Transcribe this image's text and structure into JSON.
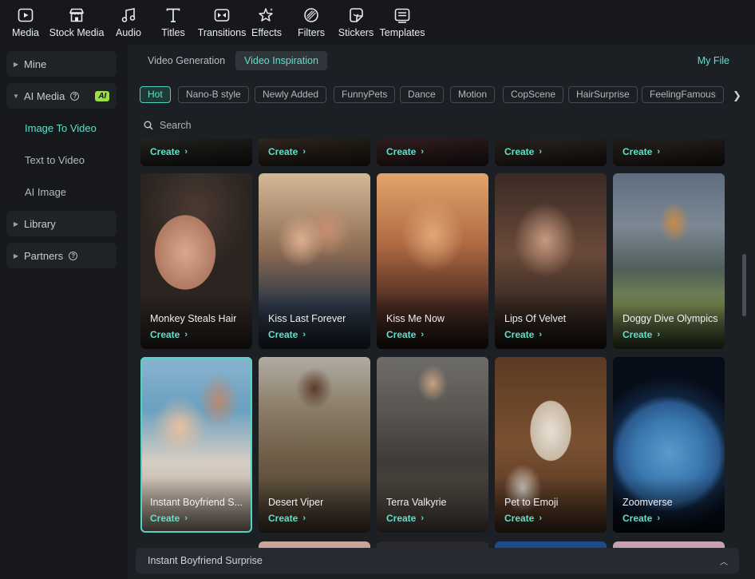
{
  "toolbar": {
    "items": [
      {
        "label": "Media",
        "icon": "media-icon",
        "active": false
      },
      {
        "label": "Stock Media",
        "icon": "store-icon",
        "active": true
      },
      {
        "label": "Audio",
        "icon": "music-note-icon",
        "active": false
      },
      {
        "label": "Titles",
        "icon": "text-t-icon",
        "active": false
      },
      {
        "label": "Transitions",
        "icon": "transition-icon",
        "active": false
      },
      {
        "label": "Effects",
        "icon": "sparkle-star-icon",
        "active": false
      },
      {
        "label": "Filters",
        "icon": "filter-circle-icon",
        "active": false
      },
      {
        "label": "Stickers",
        "icon": "sticker-icon",
        "active": false
      },
      {
        "label": "Templates",
        "icon": "template-icon",
        "active": false
      }
    ]
  },
  "sidebar": {
    "mine": "Mine",
    "ai_media": "AI Media",
    "ai_badge": "AI",
    "image_to_video": "Image To Video",
    "text_to_video": "Text to Video",
    "ai_image": "AI Image",
    "library": "Library",
    "partners": "Partners"
  },
  "tabs": {
    "video_generation": "Video Generation",
    "video_inspiration": "Video Inspiration",
    "my_file": "My File"
  },
  "chips": [
    "Hot",
    "Nano-B style",
    "Newly Added",
    "FunnyPets",
    "Dance",
    "Motion",
    "CopScene",
    "HairSurprise",
    "FeelingFamous"
  ],
  "search": {
    "placeholder": "Search"
  },
  "create_label": "Create",
  "cards_row2": [
    {
      "title": "Monkey Steals Hair"
    },
    {
      "title": "Kiss Last Forever"
    },
    {
      "title": "Kiss Me Now"
    },
    {
      "title": "Lips Of Velvet"
    },
    {
      "title": "Doggy Dive Olympics"
    }
  ],
  "cards_row3": [
    {
      "title": "Instant Boyfriend S..."
    },
    {
      "title": "Desert Viper"
    },
    {
      "title": "Terra Valkyrie"
    },
    {
      "title": "Pet to Emoji"
    },
    {
      "title": "Zoomverse"
    }
  ],
  "bottom_bar": {
    "title": "Instant Boyfriend Surprise"
  },
  "colors": {
    "accent": "#5fe0cc",
    "ai_badge": "#9be040",
    "panel": "#1c1f24"
  }
}
